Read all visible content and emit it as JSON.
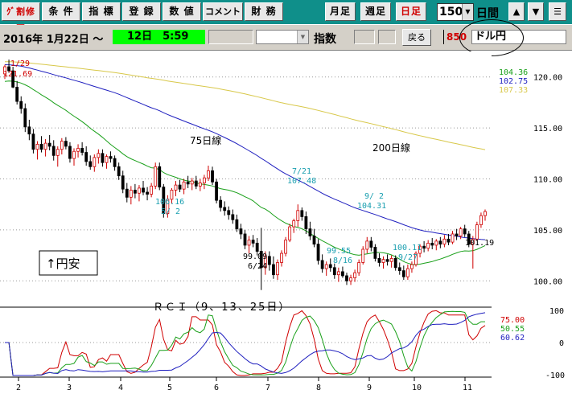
{
  "toolbar": {
    "buttons": [
      {
        "label": "ｸﾞ割修正",
        "red": true
      },
      {
        "label": "条 件",
        "red": false
      },
      {
        "label": "指 標",
        "red": false
      },
      {
        "label": "登 録",
        "red": false
      },
      {
        "label": "数 値",
        "red": false
      },
      {
        "label": "コメント",
        "red": false
      },
      {
        "label": "財 務",
        "red": false
      },
      {
        "label": "月足",
        "red": false
      },
      {
        "label": "週足",
        "red": false
      },
      {
        "label": "日足",
        "red": true
      }
    ],
    "period_value": "150",
    "period_unit": "日間",
    "up_icon": "triangle-up-icon",
    "down_icon": "triangle-down-icon",
    "menu_icon": "menu-icon"
  },
  "info_bar": {
    "date": "2016年 1月22日 ～",
    "time": "12日　5:59",
    "index_label": "指数",
    "back_label": "戻る",
    "code": "850",
    "name": "ドル円"
  },
  "chart_data": {
    "type": "candlestick",
    "y_axis": {
      "range": [
        97.5,
        122.5
      ],
      "ticks": [
        "120.00",
        "115.00",
        "110.00",
        "105.00",
        "100.00"
      ]
    },
    "x_axis": {
      "ticks": [
        "2",
        "3",
        "4",
        "5",
        "6",
        "7",
        "8",
        "9",
        "10",
        "11"
      ]
    },
    "moving_averages": [
      {
        "name": "75日線",
        "value": "102.75",
        "color": "#1f1fbf"
      },
      {
        "name": "200日線",
        "value": "107.33",
        "color": "#d8c84a"
      },
      {
        "name": "",
        "value": "104.36",
        "color": "#1aa01a"
      }
    ],
    "annotations": [
      {
        "date": "1/29",
        "value": "121.69"
      },
      {
        "value": "106.16",
        "date": "5/ 2"
      },
      {
        "value": "99.09",
        "date": "6/24"
      },
      {
        "date": "7/21",
        "value": "107.48"
      },
      {
        "date": "9/ 2",
        "value": "104.31"
      },
      {
        "value": "99.55",
        "date": "8/16"
      },
      {
        "value": "100.11",
        "date": "9/27"
      },
      {
        "value": "101.19"
      }
    ],
    "note": "↑円安",
    "candles": [
      [
        120.3,
        121.2,
        119.8,
        121.0
      ],
      [
        121.0,
        121.7,
        120.4,
        120.6
      ],
      [
        120.6,
        121.0,
        118.9,
        119.0
      ],
      [
        119.0,
        119.6,
        117.3,
        117.6
      ],
      [
        117.6,
        118.1,
        116.4,
        116.9
      ],
      [
        116.9,
        117.4,
        114.6,
        115.1
      ],
      [
        115.1,
        115.8,
        113.8,
        114.4
      ],
      [
        114.4,
        114.9,
        112.5,
        112.9
      ],
      [
        112.9,
        113.7,
        111.9,
        113.4
      ],
      [
        113.4,
        114.2,
        112.6,
        112.9
      ],
      [
        112.9,
        113.9,
        112.2,
        113.5
      ],
      [
        113.5,
        114.3,
        112.8,
        113.2
      ],
      [
        113.2,
        113.8,
        111.8,
        112.3
      ],
      [
        112.3,
        113.2,
        111.2,
        112.9
      ],
      [
        112.9,
        114.0,
        112.4,
        113.7
      ],
      [
        113.7,
        114.1,
        112.9,
        113.2
      ],
      [
        113.2,
        113.6,
        111.6,
        112.0
      ],
      [
        112.0,
        113.0,
        111.3,
        112.7
      ],
      [
        112.7,
        113.4,
        112.1,
        113.0
      ],
      [
        113.0,
        113.6,
        112.3,
        112.6
      ],
      [
        112.6,
        113.2,
        111.3,
        111.7
      ],
      [
        111.7,
        112.3,
        110.9,
        111.2
      ],
      [
        111.2,
        112.4,
        110.7,
        112.1
      ],
      [
        112.1,
        112.9,
        111.5,
        112.5
      ],
      [
        112.5,
        112.9,
        111.2,
        111.6
      ],
      [
        111.6,
        112.4,
        111.0,
        112.2
      ],
      [
        112.2,
        112.7,
        111.6,
        112.0
      ],
      [
        112.0,
        112.3,
        110.8,
        111.2
      ],
      [
        111.2,
        111.6,
        109.9,
        110.3
      ],
      [
        110.3,
        110.8,
        108.6,
        109.0
      ],
      [
        109.0,
        109.6,
        107.7,
        108.2
      ],
      [
        108.2,
        109.3,
        107.5,
        108.9
      ],
      [
        108.9,
        109.5,
        108.1,
        108.6
      ],
      [
        108.6,
        109.4,
        107.8,
        109.1
      ],
      [
        109.1,
        109.8,
        108.4,
        108.7
      ],
      [
        108.7,
        109.2,
        107.9,
        108.5
      ],
      [
        108.5,
        109.6,
        108.2,
        109.3
      ],
      [
        109.3,
        111.6,
        109.0,
        111.2
      ],
      [
        111.2,
        111.6,
        108.9,
        109.2
      ],
      [
        109.2,
        109.5,
        106.2,
        106.6
      ],
      [
        106.6,
        108.4,
        106.2,
        108.0
      ],
      [
        108.0,
        109.1,
        107.6,
        108.9
      ],
      [
        108.9,
        109.8,
        108.3,
        109.4
      ],
      [
        109.4,
        109.9,
        108.7,
        109.0
      ],
      [
        109.0,
        110.0,
        108.5,
        109.7
      ],
      [
        109.7,
        110.3,
        109.1,
        109.5
      ],
      [
        109.5,
        110.1,
        108.9,
        109.8
      ],
      [
        109.8,
        110.3,
        109.0,
        109.3
      ],
      [
        109.3,
        110.0,
        108.8,
        109.6
      ],
      [
        109.6,
        110.4,
        109.0,
        110.1
      ],
      [
        110.1,
        111.3,
        109.8,
        110.8
      ],
      [
        110.8,
        111.2,
        109.4,
        109.7
      ],
      [
        109.7,
        110.0,
        107.6,
        107.9
      ],
      [
        107.9,
        108.3,
        106.8,
        107.2
      ],
      [
        107.2,
        107.8,
        106.4,
        106.9
      ],
      [
        106.9,
        107.3,
        106.0,
        106.5
      ],
      [
        106.5,
        107.0,
        105.6,
        106.0
      ],
      [
        106.0,
        106.5,
        104.8,
        105.1
      ],
      [
        105.1,
        105.6,
        104.1,
        104.6
      ],
      [
        104.6,
        105.0,
        103.1,
        103.5
      ],
      [
        103.5,
        104.4,
        102.7,
        104.0
      ],
      [
        104.0,
        104.5,
        103.3,
        103.7
      ],
      [
        103.7,
        104.2,
        102.5,
        102.9
      ],
      [
        102.9,
        105.2,
        99.1,
        101.3
      ],
      [
        101.3,
        102.9,
        100.6,
        102.4
      ],
      [
        102.4,
        102.9,
        101.0,
        101.6
      ],
      [
        101.6,
        102.4,
        100.2,
        100.6
      ],
      [
        100.6,
        102.1,
        100.1,
        101.8
      ],
      [
        101.8,
        103.0,
        101.4,
        102.7
      ],
      [
        102.7,
        104.3,
        102.4,
        104.0
      ],
      [
        104.0,
        105.6,
        103.8,
        105.3
      ],
      [
        105.3,
        106.1,
        104.7,
        105.9
      ],
      [
        105.9,
        107.5,
        105.3,
        106.9
      ],
      [
        106.9,
        107.2,
        105.9,
        106.3
      ],
      [
        106.3,
        106.8,
        104.6,
        105.1
      ],
      [
        105.1,
        105.8,
        104.0,
        104.4
      ],
      [
        104.4,
        105.1,
        103.3,
        103.6
      ],
      [
        103.6,
        104.1,
        101.6,
        102.0
      ],
      [
        102.0,
        102.6,
        100.8,
        101.2
      ],
      [
        101.2,
        101.9,
        100.5,
        101.6
      ],
      [
        101.6,
        102.2,
        100.9,
        101.3
      ],
      [
        101.3,
        101.7,
        100.2,
        100.6
      ],
      [
        100.6,
        101.3,
        99.9,
        100.9
      ],
      [
        100.9,
        101.4,
        100.3,
        100.5
      ],
      [
        100.5,
        100.8,
        99.6,
        100.0
      ],
      [
        100.0,
        100.6,
        99.6,
        100.3
      ],
      [
        100.3,
        101.1,
        99.9,
        100.8
      ],
      [
        100.8,
        102.1,
        100.5,
        101.8
      ],
      [
        101.8,
        103.4,
        101.6,
        103.1
      ],
      [
        103.1,
        104.3,
        102.7,
        103.9
      ],
      [
        103.9,
        104.3,
        102.9,
        103.3
      ],
      [
        103.3,
        103.6,
        101.9,
        102.2
      ],
      [
        102.2,
        102.7,
        101.4,
        101.8
      ],
      [
        101.8,
        102.4,
        101.2,
        102.1
      ],
      [
        102.1,
        102.6,
        101.5,
        101.9
      ],
      [
        101.9,
        102.5,
        101.3,
        102.2
      ],
      [
        102.2,
        102.5,
        101.0,
        101.3
      ],
      [
        101.3,
        101.8,
        100.6,
        101.0
      ],
      [
        101.0,
        101.5,
        100.1,
        100.4
      ],
      [
        100.4,
        101.6,
        100.1,
        101.2
      ],
      [
        101.2,
        101.9,
        100.8,
        101.6
      ],
      [
        101.6,
        102.9,
        101.4,
        102.7
      ],
      [
        102.7,
        103.6,
        102.3,
        103.4
      ],
      [
        103.4,
        103.9,
        102.8,
        103.2
      ],
      [
        103.2,
        104.0,
        102.9,
        103.7
      ],
      [
        103.7,
        104.2,
        103.1,
        103.5
      ],
      [
        103.5,
        104.1,
        103.0,
        103.9
      ],
      [
        103.9,
        104.3,
        103.2,
        103.6
      ],
      [
        103.6,
        104.5,
        103.3,
        104.1
      ],
      [
        104.1,
        104.6,
        103.5,
        103.8
      ],
      [
        103.8,
        104.9,
        103.6,
        104.6
      ],
      [
        104.6,
        105.1,
        104.0,
        104.4
      ],
      [
        104.4,
        105.3,
        104.1,
        105.1
      ],
      [
        105.1,
        105.5,
        104.3,
        104.6
      ],
      [
        104.6,
        104.9,
        103.3,
        103.6
      ],
      [
        103.6,
        104.4,
        101.2,
        104.1
      ],
      [
        104.1,
        105.8,
        103.9,
        105.5
      ],
      [
        105.5,
        106.7,
        105.2,
        106.4
      ],
      [
        106.4,
        107.0,
        105.9,
        106.8
      ]
    ],
    "rci": {
      "title": "ＲＣＩ（9、13、25日）",
      "y_ticks": [
        "100",
        "0",
        "-100"
      ],
      "series": [
        {
          "name": "",
          "value": "75.00",
          "color": "#d00000"
        },
        {
          "name": "",
          "value": "50.55",
          "color": "#1aa01a"
        },
        {
          "name": "",
          "value": "60.62",
          "color": "#1f1fbf"
        }
      ]
    }
  }
}
